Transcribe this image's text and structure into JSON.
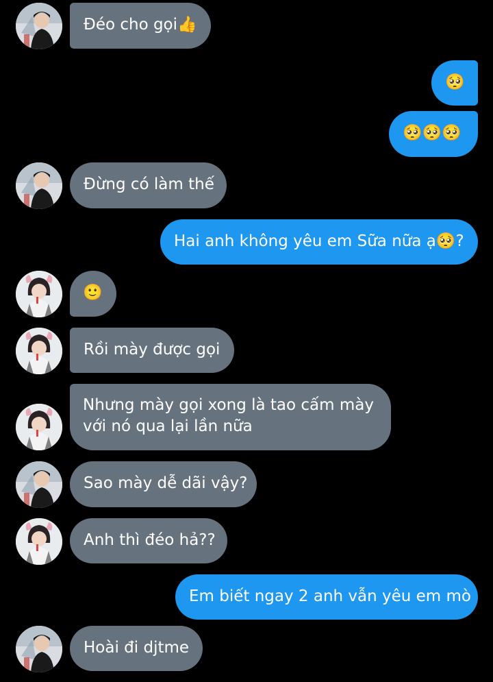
{
  "colors": {
    "background": "#000000",
    "incoming_bubble": "#66737f",
    "outgoing_bubble": "#1d97ef",
    "text": "#ffffff"
  },
  "messages": [
    {
      "side": "in",
      "avatar": "boy-avatar",
      "text": "Đéo cho gọi👍"
    },
    {
      "side": "out",
      "text": "🥺"
    },
    {
      "side": "out",
      "text": "🥺🥺🥺"
    },
    {
      "side": "in",
      "avatar": "boy-avatar",
      "text": "Đừng có làm thế"
    },
    {
      "side": "out",
      "text": "Hai anh không yêu em Sữa nữa ạ🥺?"
    },
    {
      "side": "in",
      "avatar": "girl-avatar",
      "text": "🙂"
    },
    {
      "side": "in",
      "avatar": "girl-avatar",
      "text": "Rồi mày được gọi"
    },
    {
      "side": "in",
      "avatar": "girl-avatar",
      "text": "Nhưng mày gọi xong là tao cấm mày với nó qua lại lần nữa"
    },
    {
      "side": "in",
      "avatar": "boy-avatar",
      "text": "Sao mày dễ dãi vậy?"
    },
    {
      "side": "in",
      "avatar": "girl-avatar",
      "text": "Anh thì đéo hả??"
    },
    {
      "side": "out",
      "text": "Em biết ngay 2 anh vẫn yêu em mò"
    },
    {
      "side": "in",
      "avatar": "boy-avatar",
      "text": "Hoài đi djtme"
    }
  ]
}
